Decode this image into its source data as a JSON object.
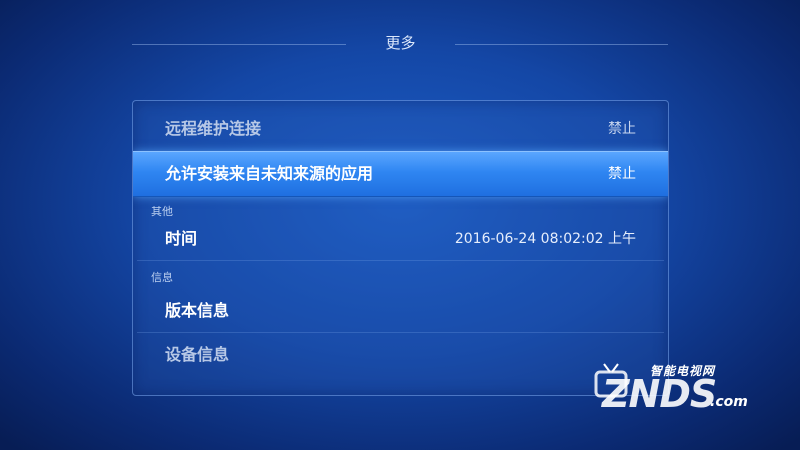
{
  "header": {
    "title": "更多"
  },
  "rows": [
    {
      "label": "远程维护连接",
      "value": "禁止"
    },
    {
      "label": "允许安装来自未知来源的应用",
      "value": "禁止"
    }
  ],
  "sections": {
    "other": "其他",
    "info": "信息"
  },
  "time_row": {
    "label": "时间",
    "value": "2016-06-24 08:02:02 上午"
  },
  "info_rows": [
    {
      "label": "版本信息"
    },
    {
      "label": "设备信息"
    }
  ],
  "watermark": {
    "brand": "ZNDS",
    "cn": "智能电视网",
    "suffix": ".com",
    "icon": "tv-icon"
  },
  "colors": {
    "selected_row": "#2f86f2",
    "background": "#1447a6"
  }
}
